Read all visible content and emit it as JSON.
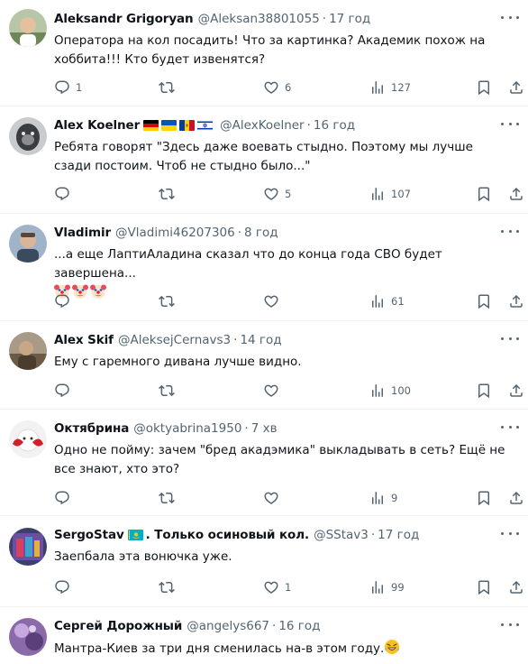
{
  "tweets": [
    {
      "name": "Aleksandr Grigoryan",
      "handle": "@Aleksan38801055",
      "dot": "·",
      "time": "17 год",
      "text": "Оператора на кол посадить! Что за картинка? Академик похож на хоббита!!! Кто будет извенятся?",
      "replies": "1",
      "retweets": "",
      "likes": "6",
      "views": "127"
    },
    {
      "name": "Alex Koelner",
      "flags": [
        "germany-flag",
        "ukraine-flag",
        "moldova-flag",
        "israel-flag"
      ],
      "handle": "@AlexKoelner",
      "dot": "·",
      "time": "16 год",
      "text": "Ребята говорят \"Здесь даже воевать стыдно. Поэтому мы лучше сзади постоим. Чтоб не стыдно было...\"",
      "replies": "",
      "retweets": "",
      "likes": "5",
      "views": "107"
    },
    {
      "name": "Vladimir",
      "handle": "@Vladimi46207306",
      "dot": "·",
      "time": "8 год",
      "text": "...а еще ЛаптиАладина сказал что до конца года СВО будет завершена...",
      "emoji": [
        "clown-face-emoji",
        "clown-face-emoji",
        "clown-face-emoji"
      ],
      "replies": "",
      "retweets": "",
      "likes": "",
      "views": "61"
    },
    {
      "name": "Alex Skif",
      "handle": "@AleksejCernavs3",
      "dot": "·",
      "time": "14 год",
      "text": "Ему с гаремного дивана лучше видно.",
      "replies": "",
      "retweets": "",
      "likes": "",
      "views": "100"
    },
    {
      "name": "Октябрина",
      "handle": "@oktyabrina1950",
      "dot": "·",
      "time": "7 хв",
      "text": "Одно не пойму: зачем \"бред акадэмика\" выкладывать в сеть? Ещё не все знают, хто это?",
      "replies": "",
      "retweets": "",
      "likes": "",
      "views": "9"
    },
    {
      "name": "SergoStav",
      "name_suffix": ". Только осиновый кол.",
      "flags": [
        "kazakhstan-flag"
      ],
      "handle": "@SStav3",
      "dot": "·",
      "time": "17 год",
      "text": "Заепбала эта вонючка уже.",
      "replies": "",
      "retweets": "",
      "likes": "1",
      "views": "99"
    },
    {
      "name": "Сергей Дорожный",
      "handle": "@angelys667",
      "dot": "·",
      "time": "16 год",
      "text": "Мантра-Киев за три дня сменилась на-в этом году.",
      "emoji": [
        "rolling-on-floor-laughing-emoji"
      ]
    }
  ],
  "colors": {
    "text": "#0f1419",
    "secondary": "#536471",
    "divider": "#eff3f4",
    "background": "#ffffff"
  }
}
